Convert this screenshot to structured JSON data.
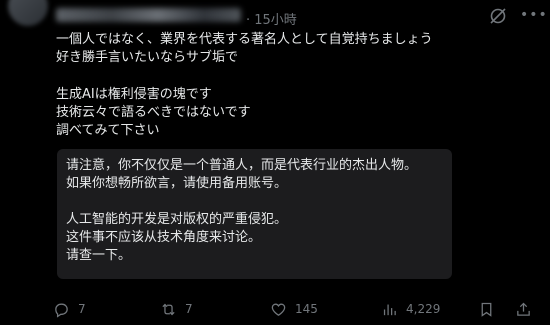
{
  "post": {
    "timestamp": "· 15小時",
    "text_lines": [
      "一個人ではなく、業界を代表する著名人として自覚持ちましょう",
      "好き勝手言いたいならサブ垢で",
      "",
      "生成AIは権利侵害の塊です",
      "技術云々で語るべきではないです",
      "調べてみて下さい"
    ]
  },
  "translation_box": {
    "lines": [
      "请注意，你不仅仅是一个普通人，而是代表行业的杰出人物。",
      "如果你想畅所欲言，请使用备用账号。",
      "",
      "人工智能的开发是对版权的严重侵犯。",
      "这件事不应该从技术角度来讨论。",
      "请查一下。"
    ]
  },
  "actions": {
    "reply_count": "7",
    "retweet_count": "7",
    "like_count": "145",
    "views_count": "4,229"
  },
  "colors": {
    "background": "#000000",
    "text": "#e7e9ea",
    "muted": "#71767b",
    "box": "#1c1c1e"
  },
  "icons": [
    "grok-icon",
    "more-icon",
    "reply-icon",
    "retweet-icon",
    "like-icon",
    "views-icon",
    "bookmark-icon",
    "share-icon"
  ]
}
